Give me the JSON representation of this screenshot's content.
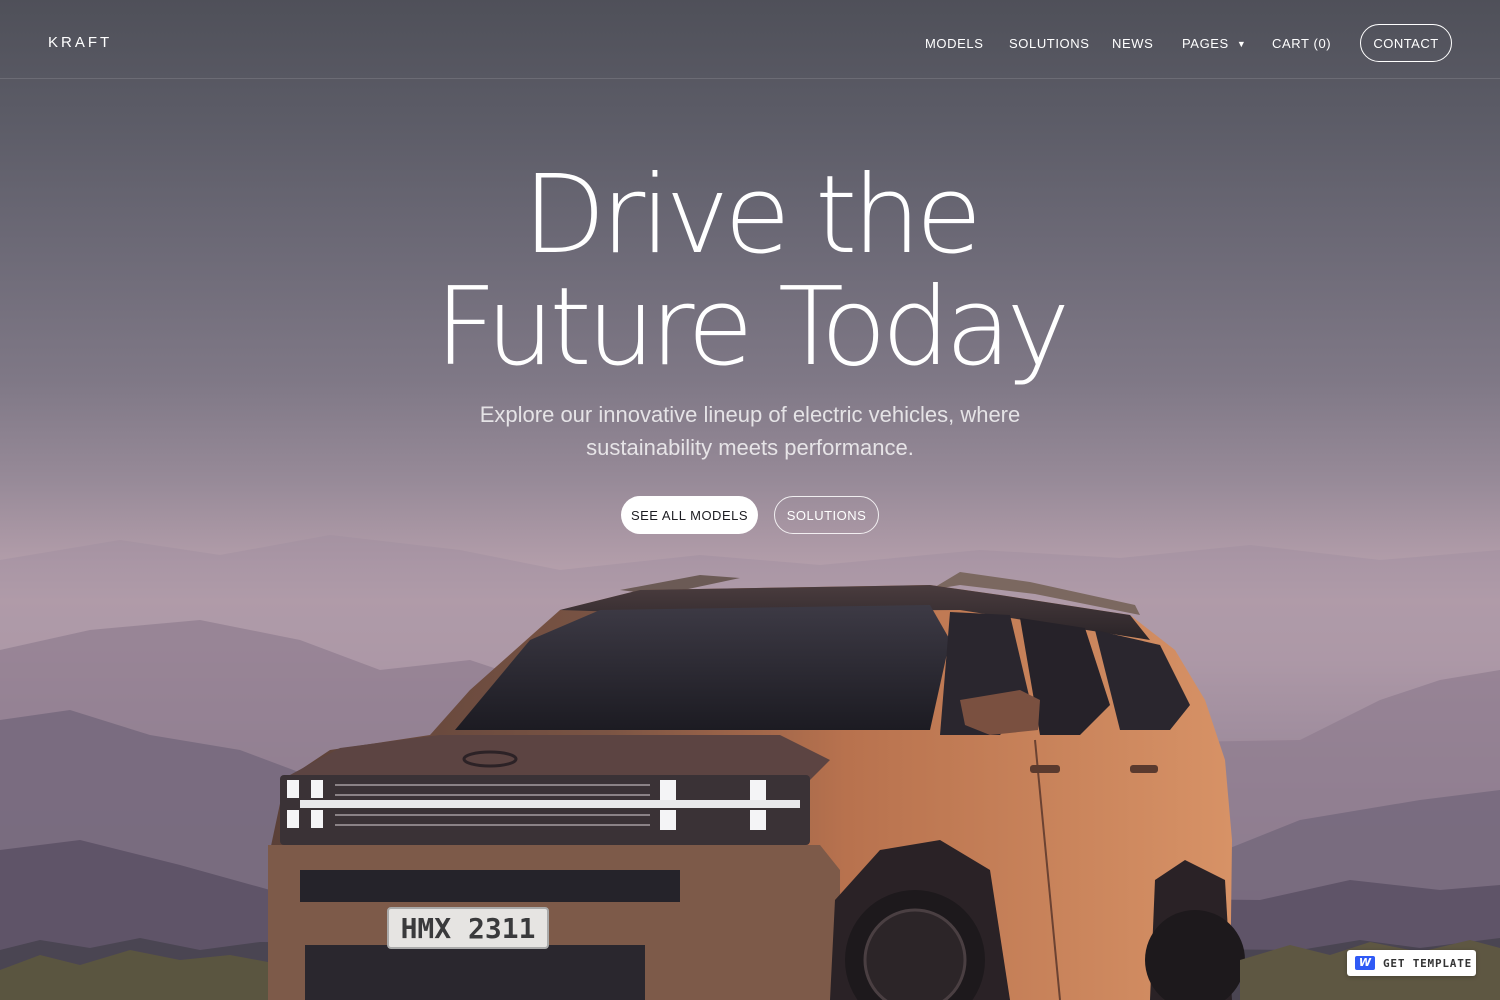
{
  "brand": {
    "logo": "KRAFT"
  },
  "nav": {
    "items": [
      {
        "label": "MODELS"
      },
      {
        "label": "SOLUTIONS"
      },
      {
        "label": "NEWS"
      },
      {
        "label": "PAGES",
        "icon": "chevron-down-icon"
      },
      {
        "label": "CART (0)"
      }
    ],
    "contact_label": "CONTACT"
  },
  "hero": {
    "title_line1": "Drive the",
    "title_line2": "Future Today",
    "subtitle": "Explore our innovative lineup of electric vehicles, where sustainability meets performance.",
    "primary_cta": "SEE ALL MODELS",
    "secondary_cta": "SOLUTIONS"
  },
  "vehicle": {
    "plate": "HMX 2311",
    "body_color": "#b8724e"
  },
  "badge": {
    "label": "GET TEMPLATE",
    "icon": "webflow-icon",
    "icon_color": "#2f5af5"
  }
}
